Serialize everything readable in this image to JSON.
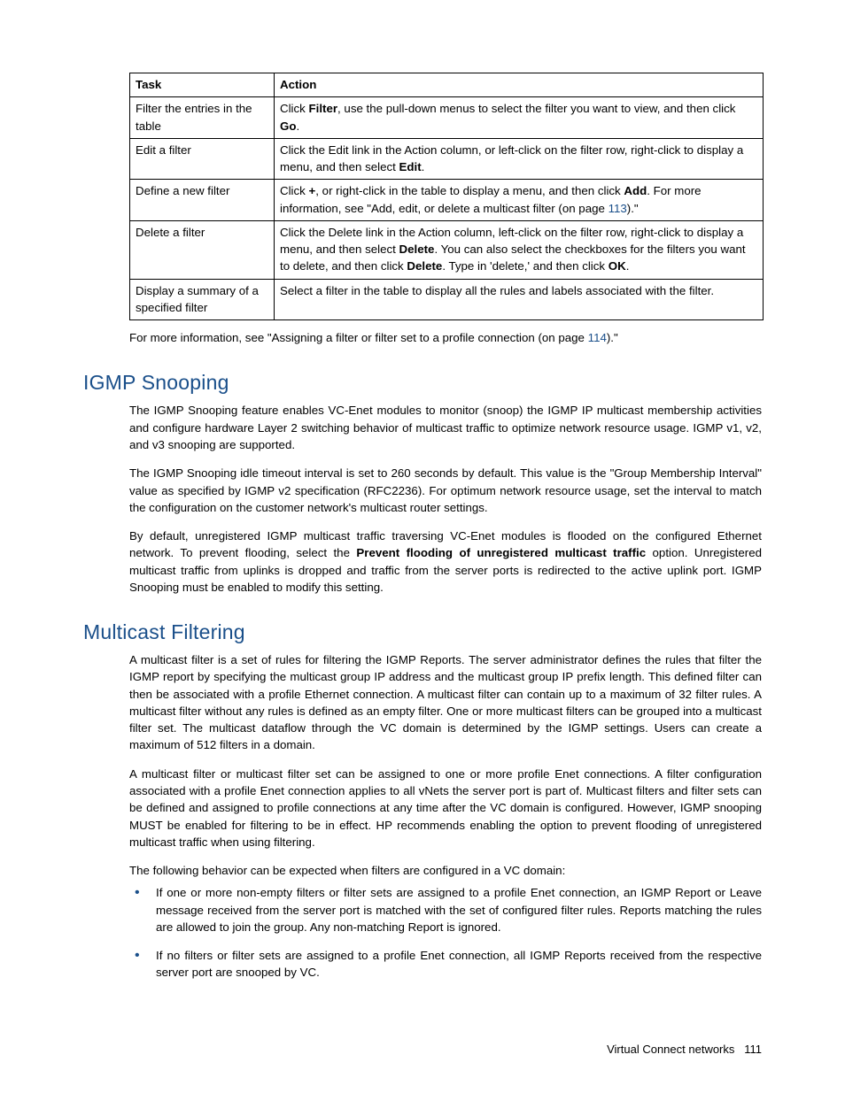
{
  "table": {
    "headers": {
      "task": "Task",
      "action": "Action"
    },
    "rows": [
      {
        "task": "Filter the entries in the table",
        "action_pre": "Click ",
        "action_b1": "Filter",
        "action_mid": ", use the pull-down menus to select the filter you want to view, and then click ",
        "action_b2": "Go",
        "action_post": "."
      },
      {
        "task": "Edit a filter",
        "action_pre": "Click the Edit link in the Action column, or left-click on the filter row, right-click to display a menu, and then select ",
        "action_b1": "Edit",
        "action_post": "."
      },
      {
        "task": "Define a new filter",
        "action_pre": "Click ",
        "action_b1": "+",
        "action_mid": ", or right-click in the table to display a menu, and then click ",
        "action_b2": "Add",
        "action_post1": ". For more information, see \"Add, edit, or delete a multicast filter (on page ",
        "action_link": "113",
        "action_post2": ").\""
      },
      {
        "task": "Delete a filter",
        "action_pre": "Click the Delete link in the Action column, left-click on the filter row, right-click to display a menu, and then select ",
        "action_b1": "Delete",
        "action_mid": ". You can also select the checkboxes for the filters you want to delete, and then click ",
        "action_b2": "Delete",
        "action_post1": ". Type in 'delete,' and then click ",
        "action_b3": "OK",
        "action_post2": "."
      },
      {
        "task": "Display a summary of a specified filter",
        "action_pre": "Select a filter in the table to display all the rules and labels associated with the filter."
      }
    ]
  },
  "table_note_pre": "For more information, see \"Assigning a filter or filter set to a profile connection (on page ",
  "table_note_link": "114",
  "table_note_post": ").\"",
  "igmp": {
    "heading": "IGMP Snooping",
    "p1": "The IGMP Snooping feature enables VC-Enet modules to monitor (snoop) the IGMP IP multicast membership activities and configure hardware Layer 2 switching behavior of multicast traffic to optimize network resource usage. IGMP v1, v2, and v3 snooping are supported.",
    "p2": "The IGMP Snooping idle timeout interval is set to 260 seconds by default. This value is the \"Group Membership Interval\" value as specified by IGMP v2 specification (RFC2236). For optimum network resource usage, set the interval to match the configuration on the customer network's multicast router settings.",
    "p3_pre": "By default, unregistered IGMP multicast traffic traversing VC-Enet modules is flooded on the configured Ethernet network. To prevent flooding, select the ",
    "p3_b": "Prevent flooding of unregistered multicast traffic",
    "p3_post": " option. Unregistered multicast traffic from uplinks is dropped and traffic from the server ports is redirected to the active uplink port. IGMP Snooping must be enabled to modify this setting."
  },
  "mf": {
    "heading": "Multicast Filtering",
    "p1": "A multicast filter is a set of rules for filtering the IGMP Reports. The server administrator defines the rules that filter the IGMP report by specifying the multicast group IP address and the multicast group IP prefix length. This defined filter can then be associated with a profile Ethernet connection. A multicast filter can contain up to a maximum of 32 filter rules. A multicast filter without any rules is defined as an empty filter. One or more multicast filters can be grouped into a multicast filter set. The multicast dataflow through the VC domain is determined by the IGMP settings. Users can create a maximum of 512 filters in a domain.",
    "p2": "A multicast filter or multicast filter set can be assigned to one or more profile Enet connections. A filter configuration associated with a profile Enet connection applies to all vNets the server port is part of. Multicast filters and filter sets can be defined and assigned to profile connections at any time after the VC domain is configured. However, IGMP snooping MUST be enabled for filtering to be in effect. HP recommends enabling the option to prevent flooding of unregistered multicast traffic when using filtering.",
    "p3": "The following behavior can be expected when filters are configured in a VC domain:",
    "bullets": [
      "If one or more non-empty filters or filter sets are assigned to a profile Enet connection, an IGMP Report or Leave message received from the server port is matched with the set of configured filter rules. Reports matching the rules are allowed to join the group. Any non-matching Report is ignored.",
      "If no filters or filter sets are assigned to a profile Enet connection, all IGMP Reports received from the respective server port are snooped by VC."
    ]
  },
  "footer": {
    "section": "Virtual Connect networks",
    "page": "111"
  }
}
